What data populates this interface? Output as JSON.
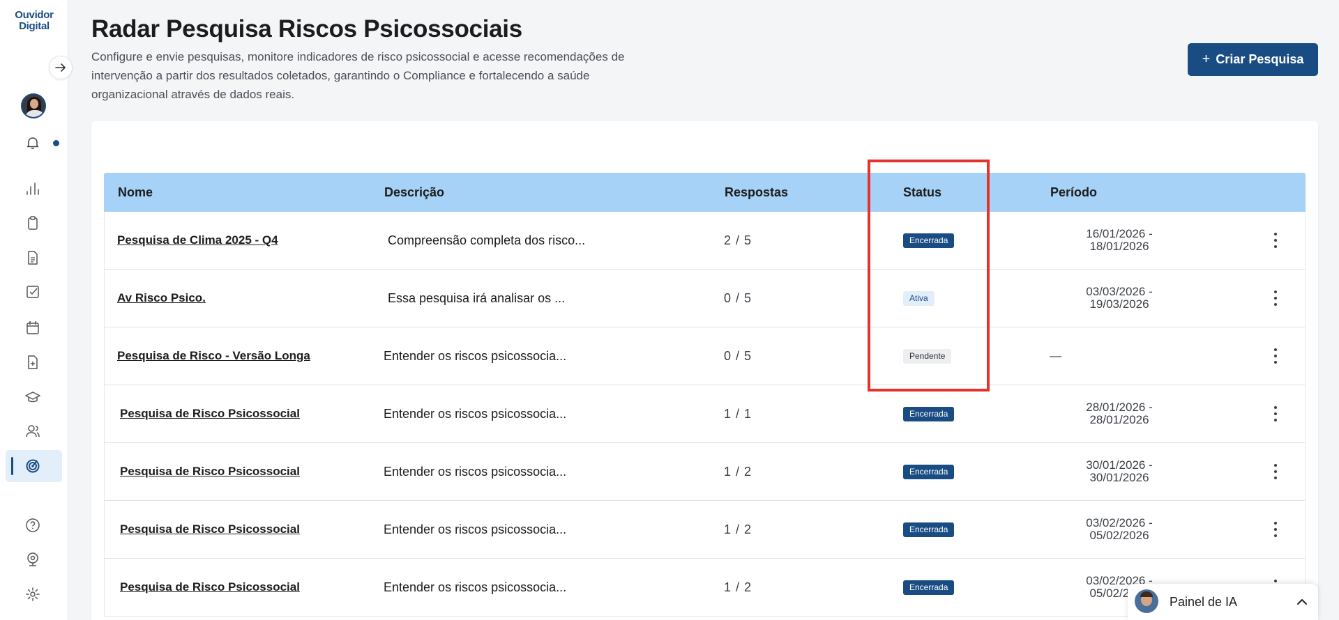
{
  "sidebar": {
    "logo_line1": "Ouvidor",
    "logo_line2": "Digital",
    "items": [
      {
        "icon": "bar-chart-icon"
      },
      {
        "icon": "clipboard-icon"
      },
      {
        "icon": "document-icon"
      },
      {
        "icon": "checkbox-icon"
      },
      {
        "icon": "calendar-icon"
      },
      {
        "icon": "file-plus-icon"
      },
      {
        "icon": "graduation-cap-icon"
      },
      {
        "icon": "users-icon"
      },
      {
        "icon": "radar-icon",
        "active": true
      },
      {
        "icon": "help-icon"
      },
      {
        "icon": "webcam-icon"
      },
      {
        "icon": "gear-icon"
      }
    ]
  },
  "header": {
    "title": "Radar Pesquisa Riscos Psicossociais",
    "description": "Configure e envie pesquisas, monitore indicadores de risco psicossocial e acesse recomendações de intervenção a partir dos resultados coletados, garantindo o Compliance e fortalecendo a saúde organizacional através de dados reais.",
    "create_button": "Criar Pesquisa",
    "create_icon": "+"
  },
  "table": {
    "columns": {
      "name": "Nome",
      "description": "Descrição",
      "responses": "Respostas",
      "status": "Status",
      "period": "Período"
    },
    "rows": [
      {
        "name": "Pesquisa de Clima 2025 - Q4",
        "description": "Compreensão completa dos risco...",
        "responses": "2 / 5",
        "status": "Encerrada",
        "status_style": "dark",
        "period_start": "16/01/2026 -",
        "period_end": "18/01/2026"
      },
      {
        "name": "Av Risco Psico.",
        "description": "Essa pesquisa irá analisar os ...",
        "responses": "0 / 5",
        "status": "Ativa",
        "status_style": "light",
        "period_start": "03/03/2026 -",
        "period_end": "19/03/2026"
      },
      {
        "name": "Pesquisa de Risco - Versão Longa",
        "description": "Entender os riscos psicossocia...",
        "responses": "0 / 5",
        "status": "Pendente",
        "status_style": "gray",
        "period_start": "—",
        "period_end": ""
      },
      {
        "name": "Pesquisa de Risco Psicossocial",
        "description": "Entender os riscos psicossocia...",
        "responses": "1 / 1",
        "status": "Encerrada",
        "status_style": "dark",
        "period_start": "28/01/2026 -",
        "period_end": "28/01/2026"
      },
      {
        "name": "Pesquisa de Risco Psicossocial",
        "description": "Entender os riscos psicossocia...",
        "responses": "1 / 2",
        "status": "Encerrada",
        "status_style": "dark",
        "period_start": "30/01/2026 -",
        "period_end": "30/01/2026"
      },
      {
        "name": "Pesquisa de Risco Psicossocial",
        "description": "Entender os riscos psicossocia...",
        "responses": "1 / 2",
        "status": "Encerrada",
        "status_style": "dark",
        "period_start": "03/02/2026 -",
        "period_end": "05/02/2026"
      },
      {
        "name": "Pesquisa de Risco Psicossocial",
        "description": "Entender os riscos psicossocia...",
        "responses": "1 / 2",
        "status": "Encerrada",
        "status_style": "dark",
        "period_start": "03/02/2026 -",
        "period_end": "05/02/2026"
      }
    ]
  },
  "ia_panel": {
    "label": "Painel de IA"
  },
  "colors": {
    "brand": "#1a4c84",
    "table_header": "#a7d2f7",
    "highlight": "#e5322d"
  }
}
